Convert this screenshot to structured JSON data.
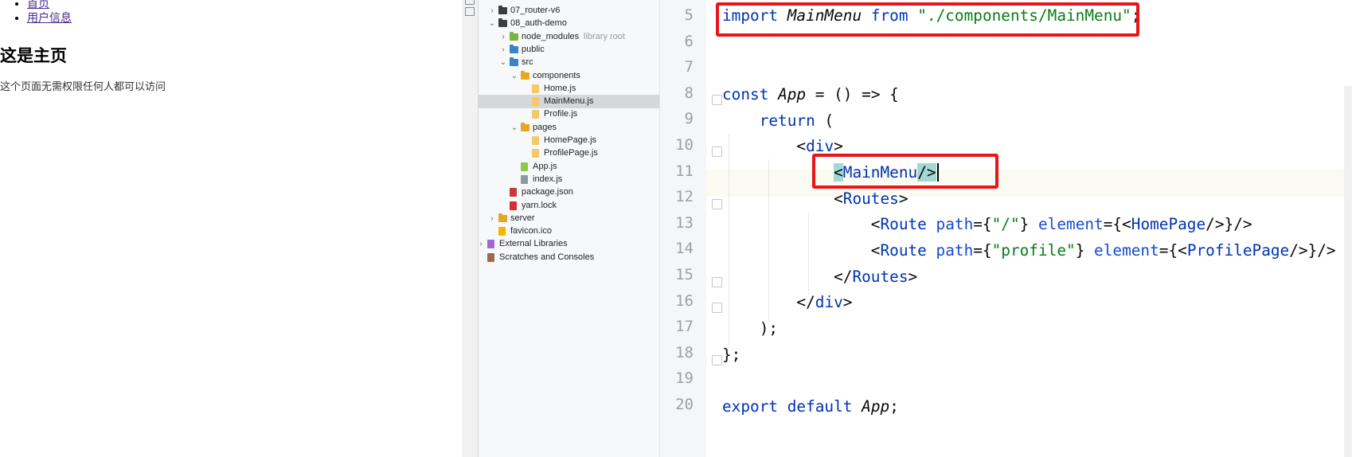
{
  "browser": {
    "nav": [
      {
        "label": "首页"
      },
      {
        "label": "用户信息"
      }
    ],
    "heading": "这是主页",
    "description": "这个页面无需权限任何人都可以访问"
  },
  "project_tree": {
    "items": [
      {
        "label": "07_router-v6",
        "chevron": "›",
        "icon": "folder-icon",
        "color": "#3d3d3d"
      },
      {
        "label": "08_auth-demo",
        "chevron": "⌄",
        "icon": "folder-icon",
        "color": "#3d3d3d"
      },
      {
        "label": "node_modules",
        "hint": "library root",
        "chevron": "›",
        "icon": "folder-icon",
        "color": "#7cb342"
      },
      {
        "label": "public",
        "chevron": "›",
        "icon": "folder-icon",
        "color": "#3b82c4"
      },
      {
        "label": "src",
        "chevron": "⌄",
        "icon": "folder-icon",
        "color": "#3b82c4"
      },
      {
        "label": "components",
        "chevron": "⌄",
        "icon": "folder-icon",
        "color": "#e9a524"
      },
      {
        "label": "Home.js",
        "icon": "js-file-icon",
        "color": "#f3c969"
      },
      {
        "label": "MainMenu.js",
        "icon": "js-file-icon",
        "color": "#f3c969",
        "selected": true
      },
      {
        "label": "Profile.js",
        "icon": "js-file-icon",
        "color": "#f3c969"
      },
      {
        "label": "pages",
        "chevron": "⌄",
        "icon": "folder-icon",
        "color": "#e9a524"
      },
      {
        "label": "HomePage.js",
        "icon": "js-file-icon",
        "color": "#f3c969"
      },
      {
        "label": "ProfilePage.js",
        "icon": "js-file-icon",
        "color": "#f3c969"
      },
      {
        "label": "App.js",
        "icon": "node-file-icon",
        "color": "#8cc84b"
      },
      {
        "label": "index.js",
        "icon": "text-file-icon",
        "color": "#8b98a6"
      },
      {
        "label": "package.json",
        "icon": "json-file-icon",
        "color": "#c73a3a"
      },
      {
        "label": "yarn.lock",
        "icon": "lock-icon",
        "color": "#d32f2f"
      },
      {
        "label": "server",
        "chevron": "›",
        "icon": "folder-icon",
        "color": "#e9a524"
      },
      {
        "label": "favicon.ico",
        "icon": "star-icon",
        "color": "#f5b400"
      },
      {
        "label": "External Libraries",
        "chevron": "›",
        "icon": "library-icon",
        "color": "#9c6ad6"
      },
      {
        "label": "Scratches and Consoles",
        "icon": "scratches-icon",
        "color": "#a06a4a"
      }
    ]
  },
  "editor": {
    "current_line": 11,
    "lines": [
      {
        "no": "5"
      },
      {
        "no": "6"
      },
      {
        "no": "7"
      },
      {
        "no": "8"
      },
      {
        "no": "9"
      },
      {
        "no": "10"
      },
      {
        "no": "11"
      },
      {
        "no": "12"
      },
      {
        "no": "13"
      },
      {
        "no": "14"
      },
      {
        "no": "15"
      },
      {
        "no": "16"
      },
      {
        "no": "17"
      },
      {
        "no": "18"
      },
      {
        "no": "19"
      },
      {
        "no": "20"
      }
    ],
    "code": {
      "l5": {
        "import": "import",
        "name": "MainMenu",
        "from": "from",
        "path": "\"./components/MainMenu\"",
        "end": ";"
      },
      "l8": {
        "const": "const",
        "name": "App",
        "rest": " = () => {"
      },
      "l9": {
        "return": "return",
        "rest": " ("
      },
      "l10": {
        "open": "<",
        "tag": "div",
        "close": ">"
      },
      "l11": {
        "open": "<",
        "tag": "MainMenu",
        "close": "/>"
      },
      "l12": {
        "open": "<",
        "tag": "Routes",
        "close": ">"
      },
      "l13": {
        "open": "<",
        "tag": "Route",
        "attr1": "path",
        "eq1": "={",
        "val1": "\"/\"",
        "mid": "} ",
        "attr2": "element",
        "eq2": "={<",
        "comp": "HomePage",
        "end": "/>}/>"
      },
      "l14": {
        "open": "<",
        "tag": "Route",
        "attr1": "path",
        "eq1": "={",
        "val1": "\"profile\"",
        "mid": "} ",
        "attr2": "element",
        "eq2": "={<",
        "comp": "ProfilePage",
        "end": "/>}/>"
      },
      "l15": {
        "open": "</",
        "tag": "Routes",
        "close": ">"
      },
      "l16": {
        "open": "</",
        "tag": "div",
        "close": ">"
      },
      "l17": {
        "text": ");"
      },
      "l18": {
        "text": "};"
      },
      "l20": {
        "export": "export",
        "default": "default",
        "name": "App",
        "end": ";"
      }
    }
  },
  "colors": {
    "annotation": "#e8151b",
    "keyword": "#0033b3",
    "string": "#067d17",
    "tag_highlight": "#a2d9d4"
  }
}
